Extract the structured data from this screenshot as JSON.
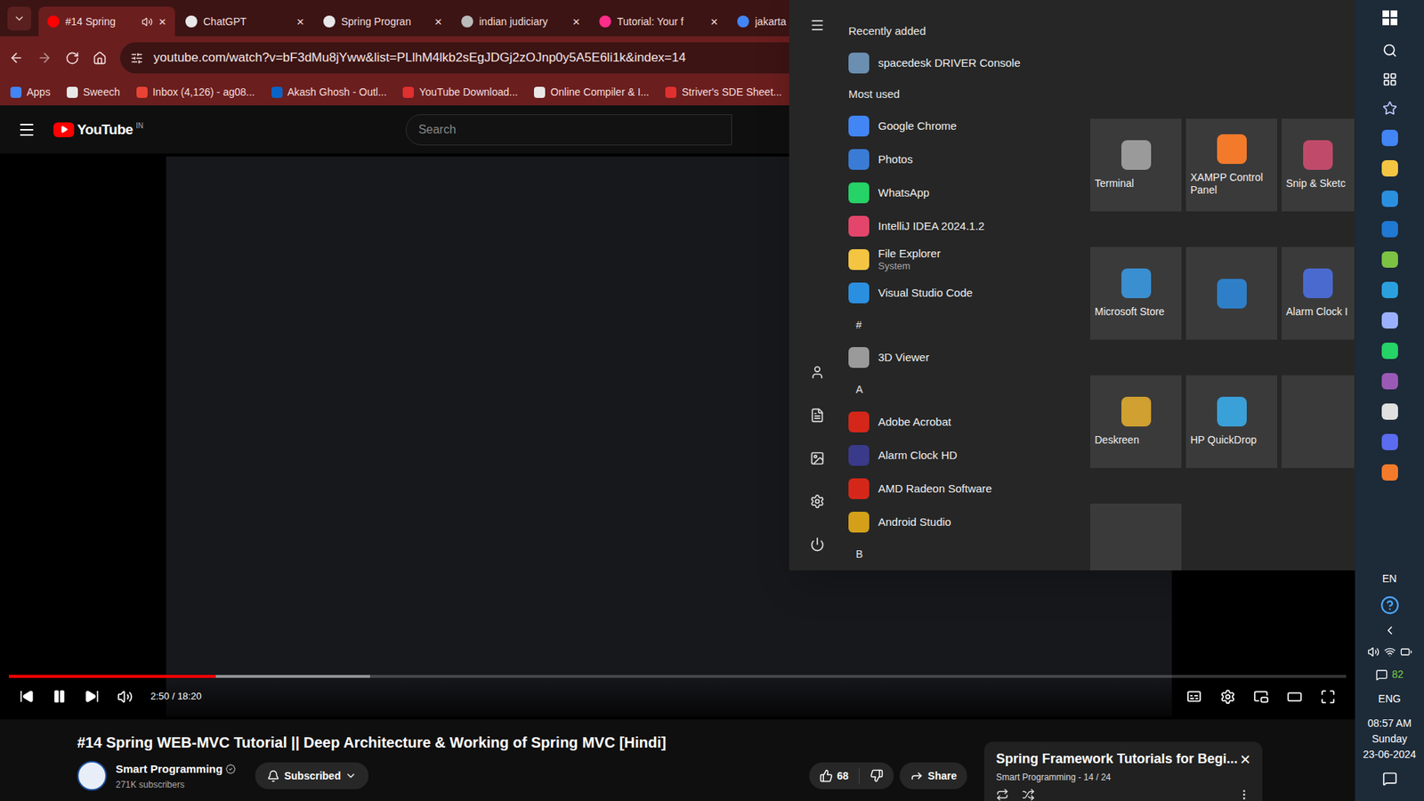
{
  "tabs": [
    {
      "label": "#14 Spring",
      "selected": true,
      "audio": true
    },
    {
      "label": "ChatGPT",
      "selected": false,
      "audio": false
    },
    {
      "label": "Spring Progran",
      "selected": false,
      "audio": false
    },
    {
      "label": "indian judiciary",
      "selected": false,
      "audio": false
    },
    {
      "label": "Tutorial: Your f",
      "selected": false,
      "audio": false
    },
    {
      "label": "jakarta ee - Go",
      "selected": false,
      "audio": false
    }
  ],
  "tab_close": "×",
  "url": "youtube.com/watch?v=bF3dMu8jYww&list=PLlhM4lkb2sEgJDGj2zOJnp0y5A5E6li1k&index=14",
  "bookmarks": [
    "Apps",
    "Sweech",
    "Inbox (4,126) - ag08...",
    "Akash Ghosh - Outl...",
    "YouTube Download...",
    "Online Compiler & I...",
    "Striver's SDE Sheet..."
  ],
  "youtube": {
    "logo": "YouTube",
    "region": "IN",
    "search_placeholder": "Search",
    "player": {
      "playing": true,
      "progress": 0.155,
      "buffered": 0.27,
      "time": "2:50 / 18:20"
    },
    "title": "#14 Spring WEB-MVC Tutorial || Deep Architecture & Working of Spring MVC [Hindi]",
    "channel": {
      "name": "Smart Programming",
      "subscribers": "271K subscribers",
      "verified": true,
      "subscribe_label": "Subscribed"
    },
    "likes": "68",
    "share": "Share",
    "playlist": {
      "title": "Spring Framework Tutorials for Begi...",
      "meta": "Smart Programming - 14 / 24",
      "close": "×"
    }
  },
  "start_menu": {
    "items": [
      {
        "kind": "header",
        "label": "Recently added"
      },
      {
        "kind": "app",
        "label": "spacedesk DRIVER Console",
        "color": "#6a8fb0"
      },
      {
        "kind": "header",
        "label": "Most used"
      },
      {
        "kind": "app",
        "label": "Google Chrome",
        "color": "#4285f4"
      },
      {
        "kind": "app",
        "label": "Photos",
        "color": "#3a7bd5"
      },
      {
        "kind": "app",
        "label": "WhatsApp",
        "color": "#25d366"
      },
      {
        "kind": "app",
        "label": "IntelliJ IDEA 2024.1.2",
        "color": "#e3466a"
      },
      {
        "kind": "app",
        "label": "File Explorer",
        "subtitle": "System",
        "color": "#f4c542"
      },
      {
        "kind": "app",
        "label": "Visual Studio Code",
        "color": "#2b8fe0"
      },
      {
        "kind": "letter",
        "label": "#"
      },
      {
        "kind": "app",
        "label": "3D Viewer",
        "color": "#9a9a9a"
      },
      {
        "kind": "letter",
        "label": "A"
      },
      {
        "kind": "app",
        "label": "Adobe Acrobat",
        "color": "#d4271a"
      },
      {
        "kind": "app",
        "label": "Alarm Clock HD",
        "color": "#3a3a8a"
      },
      {
        "kind": "app",
        "label": "AMD Radeon Software",
        "color": "#d4271a"
      },
      {
        "kind": "app",
        "label": "Android Studio",
        "color": "#d4a01a"
      },
      {
        "kind": "letter",
        "label": "B"
      }
    ],
    "tiles": [
      {
        "label": "Terminal",
        "color": "#9a9a9a"
      },
      {
        "label": "XAMPP Control Panel",
        "color": "#f37a2b"
      },
      {
        "label": "Snip & Sketc",
        "color": "#c04a6a"
      },
      {
        "label": "Microsoft Store",
        "color": "#3a8fd0"
      },
      {
        "label": "",
        "color": "#2f7fc8"
      },
      {
        "label": "Alarm Clock I",
        "color": "#4a6ad0"
      },
      {
        "label": "Deskreen",
        "color": "#d0a030"
      },
      {
        "label": "HP QuickDrop",
        "color": "#3aa0d8"
      }
    ]
  },
  "taskbar": {
    "language": "EN",
    "battery": "82",
    "input": "ENG",
    "time": "08:57 AM",
    "day": "Sunday",
    "date": "23-06-2024"
  }
}
